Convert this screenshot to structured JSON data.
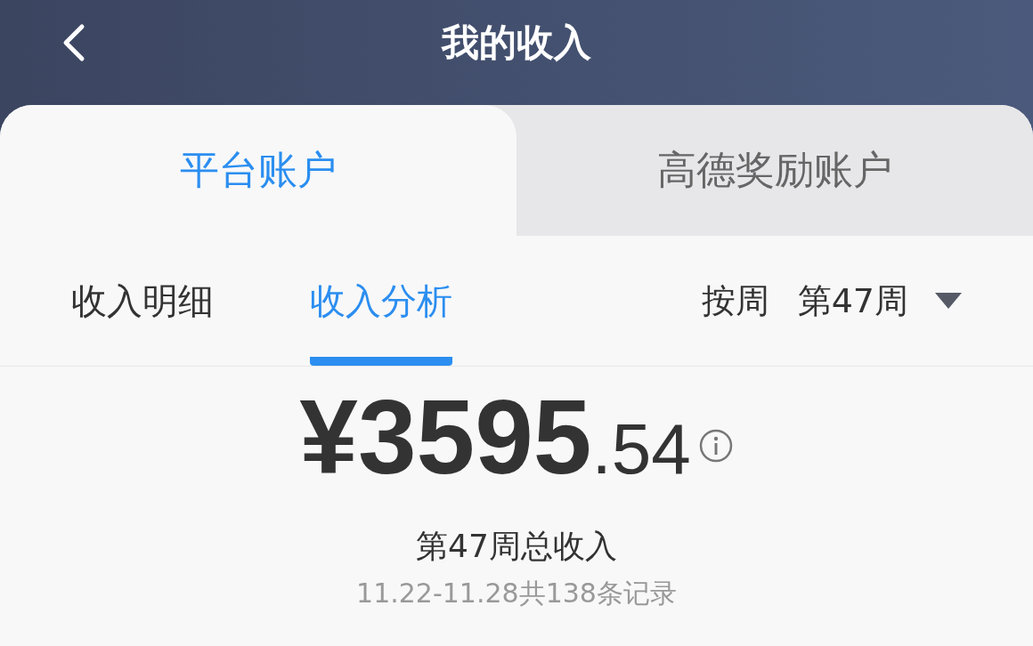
{
  "header": {
    "title": "我的收入"
  },
  "account_tabs": [
    {
      "label": "平台账户",
      "selected": true
    },
    {
      "label": "高德奖励账户",
      "selected": false
    }
  ],
  "sub_tabs": [
    {
      "label": "收入明细",
      "selected": false
    },
    {
      "label": "收入分析",
      "selected": true
    }
  ],
  "period": {
    "mode": "按周",
    "week": "第47周"
  },
  "summary": {
    "currency": "¥",
    "integer": "3595",
    "decimal": ".54",
    "label": "第47周总收入",
    "range": "11.22-11.28共138条记录"
  }
}
